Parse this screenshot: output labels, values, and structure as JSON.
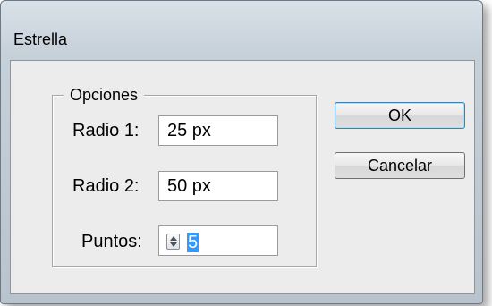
{
  "dialog": {
    "title": "Estrella"
  },
  "options": {
    "legend": "Opciones",
    "radius1": {
      "label": "Radio 1:",
      "value": "25 px"
    },
    "radius2": {
      "label": "Radio 2:",
      "value": "50 px"
    },
    "points": {
      "label": "Puntos:",
      "value": "5"
    }
  },
  "buttons": {
    "ok": "OK",
    "cancel": "Cancelar"
  },
  "colors": {
    "selection": "#3399ff",
    "dialog_background": "#ececec",
    "window_frame": "#b9c3cc"
  },
  "icons": {
    "spinner": "up-down-arrows-icon"
  }
}
